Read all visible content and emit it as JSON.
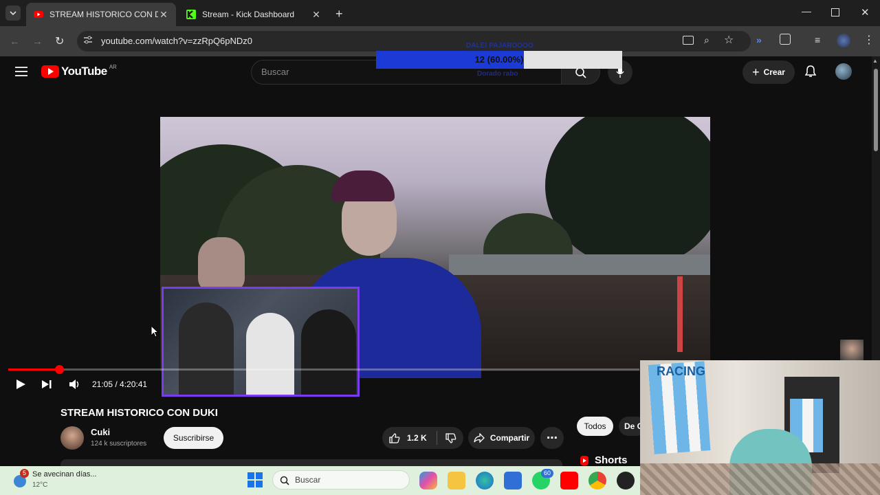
{
  "browser": {
    "tabs": [
      {
        "label": "STREAM HISTORICO CON DUKI",
        "active": true
      },
      {
        "label": "Stream - Kick Dashboard",
        "active": false
      }
    ],
    "url": "youtube.com/watch?v=zzRpQ6pNDz0"
  },
  "youtube": {
    "logo_text": "YouTube",
    "country": "AR",
    "search_placeholder": "Buscar",
    "create_label": "Crear",
    "video_title": "STREAM HISTORICO CON DUKI",
    "time": "21:05 / 4:20:41",
    "progress": 0.0808,
    "channel": {
      "name": "Cuki",
      "subs": "124 k suscriptores"
    },
    "subscribe_label": "Suscribirse",
    "likes": "1.2 K",
    "share_label": "Compartir",
    "chips": [
      "Todos",
      "De C"
    ],
    "shorts_label": "Shorts"
  },
  "overlay": {
    "poll_top": "DALE! PAJAROOOO",
    "poll_value": "12 (60.00%)",
    "poll_fraction": 0.6,
    "poll_bottom": "Dorado rabo"
  },
  "taskbar": {
    "weather_text": "Se avecinan días...",
    "temp": "12°C",
    "weather_badge": "5",
    "search_label": "Buscar",
    "whatsapp_badge": "60"
  },
  "colors": {
    "accent_red": "#ff0000",
    "poll_blue": "#1c3bd6",
    "cam_border": "#7b3cf0"
  }
}
